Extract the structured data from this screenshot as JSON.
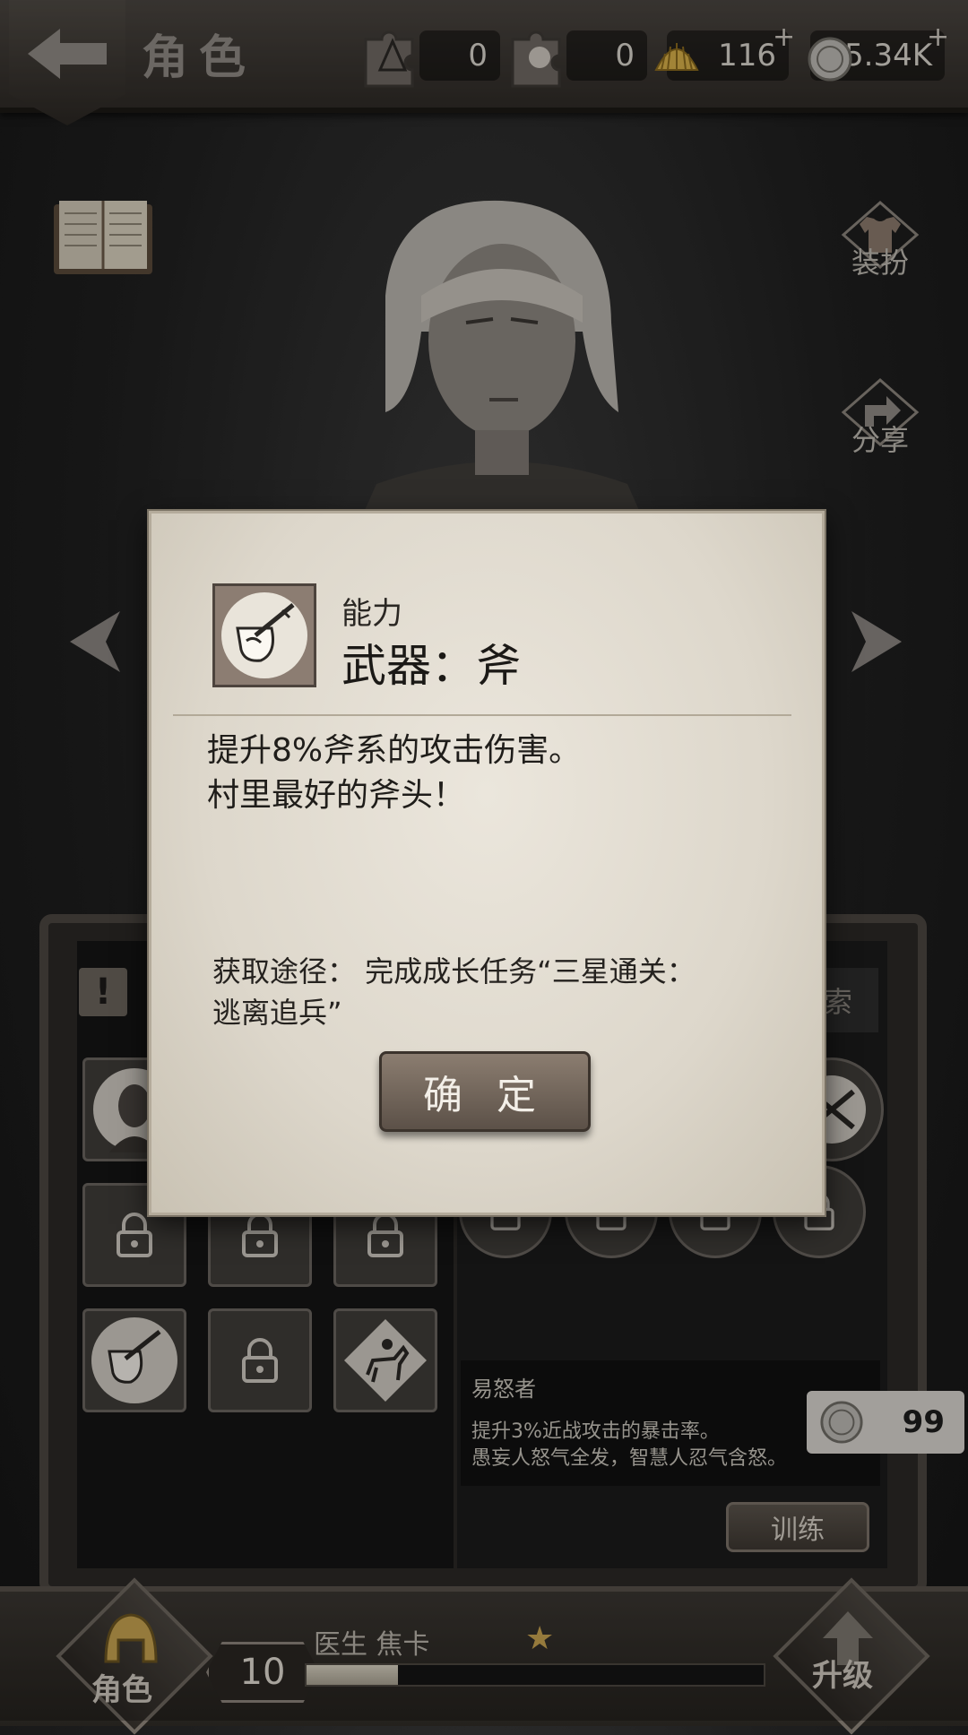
{
  "header": {
    "title": "角色",
    "resources": [
      {
        "name": "puzzle-piece-a",
        "value": "0"
      },
      {
        "name": "puzzle-piece-b",
        "value": "0"
      },
      {
        "name": "shell",
        "value": "116"
      },
      {
        "name": "coin",
        "value": "5.34K"
      }
    ],
    "plus": "+"
  },
  "side": {
    "outfit_label": "装扮",
    "share_label": "分享"
  },
  "dialog": {
    "category": "能力",
    "name": "武器：斧",
    "desc_line1": "提升8%斧系的攻击伤害。",
    "desc_line2": "村里最好的斧头！",
    "source_line1": "获取途径： 完成成长任务“三星通关：",
    "source_line2": "逃离追兵”",
    "confirm_label": "确 定"
  },
  "panel": {
    "warning_glyph": "!",
    "right_tab_partial": "索",
    "trait_title": "易怒者",
    "trait_desc": "提升3%近战攻击的暴击率。\n愚妄人怒气全发，智慧人忍气含怒。",
    "train_label": "训练",
    "cost_value": "99"
  },
  "footer": {
    "role_label": "角色",
    "level": "10",
    "character_name": "医生 焦卡",
    "upgrade_label": "升级",
    "exp_fraction": 0.2,
    "star_glyph": "★"
  },
  "colors": {
    "dialog_bg": "#e3ddd1",
    "confirm_bg": "#7a6d61",
    "dark_bg": "#1f1f1f"
  }
}
